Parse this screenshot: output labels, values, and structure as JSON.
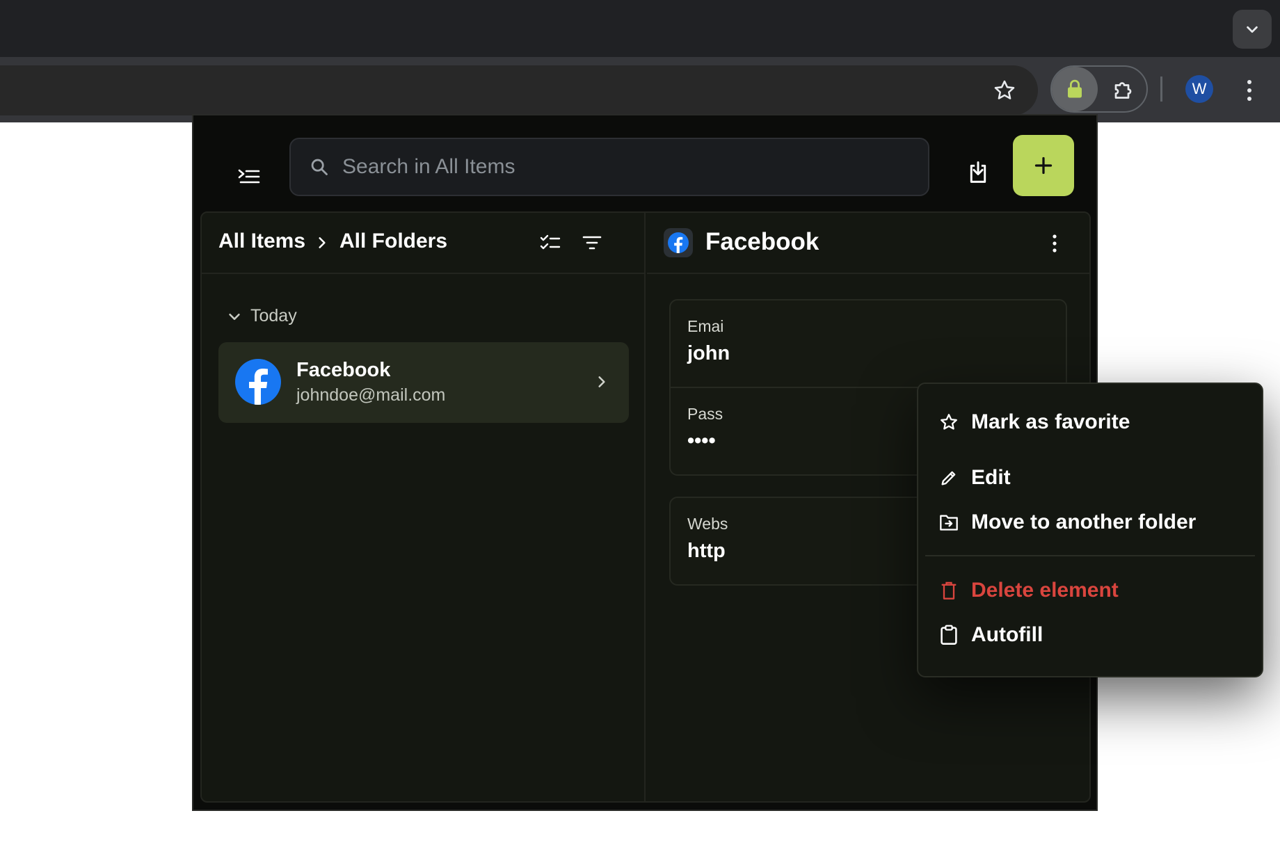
{
  "browser": {
    "avatar_letter": "W",
    "accent_lock": "#bad65c"
  },
  "popup": {
    "search_placeholder": "Search in All Items",
    "breadcrumb": [
      "All Items",
      "All Folders"
    ],
    "group": "Today",
    "items": [
      {
        "title": "Facebook",
        "subtitle": "johndoe@mail.com",
        "icon": "facebook-logo"
      }
    ],
    "detail": {
      "title": "Facebook",
      "fields": [
        {
          "label": "Emai",
          "value": "john"
        },
        {
          "label": "Pass",
          "value": "••••"
        },
        {
          "label": "Webs",
          "value": "http"
        }
      ]
    },
    "menu": {
      "items": [
        {
          "label": "Mark as favorite",
          "icon": "star-outline-icon"
        },
        {
          "label": "Edit",
          "icon": "pencil-icon"
        },
        {
          "label": "Move to another folder",
          "icon": "folder-move-icon"
        },
        {
          "label": "Delete element",
          "icon": "trash-icon",
          "danger": true
        },
        {
          "label": "Autofill",
          "icon": "clipboard-icon"
        }
      ]
    },
    "colors": {
      "accent": "#bad65c",
      "danger": "#d9453e",
      "facebook_blue": "#1877f2"
    }
  }
}
